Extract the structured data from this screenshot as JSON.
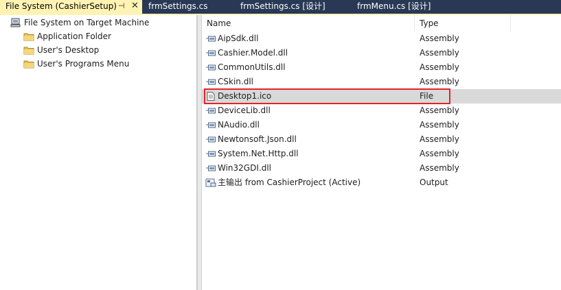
{
  "tabs": [
    {
      "label": "File System (CashierSetup)",
      "pin_glyph": "⊣",
      "close_glyph": "✕"
    },
    {
      "label": "frmSettings.cs"
    },
    {
      "label": "frmSettings.cs [设计]"
    },
    {
      "label": "frmMenu.cs [设计]"
    }
  ],
  "tree": {
    "root": {
      "label": "File System on Target Machine",
      "icon": "computer-icon"
    },
    "children": [
      {
        "label": "Application Folder",
        "icon": "folder-icon"
      },
      {
        "label": "User's Desktop",
        "icon": "folder-icon"
      },
      {
        "label": "User's Programs Menu",
        "icon": "folder-icon"
      }
    ]
  },
  "list": {
    "columns": {
      "name": "Name",
      "type": "Type"
    },
    "rows": [
      {
        "name": "AipSdk.dll",
        "type": "Assembly",
        "icon": "assembly-icon"
      },
      {
        "name": "Cashier.Model.dll",
        "type": "Assembly",
        "icon": "assembly-icon"
      },
      {
        "name": "CommonUtils.dll",
        "type": "Assembly",
        "icon": "assembly-icon"
      },
      {
        "name": "CSkin.dll",
        "type": "Assembly",
        "icon": "assembly-icon"
      },
      {
        "name": "Desktop1.ico",
        "type": "File",
        "icon": "file-icon",
        "selected": true
      },
      {
        "name": "DeviceLib.dll",
        "type": "Assembly",
        "icon": "assembly-icon"
      },
      {
        "name": "NAudio.dll",
        "type": "Assembly",
        "icon": "assembly-icon"
      },
      {
        "name": "Newtonsoft.Json.dll",
        "type": "Assembly",
        "icon": "assembly-icon"
      },
      {
        "name": "System.Net.Http.dll",
        "type": "Assembly",
        "icon": "assembly-icon"
      },
      {
        "name": "Win32GDI.dll",
        "type": "Assembly",
        "icon": "assembly-icon"
      },
      {
        "name": "主输出 from CashierProject (Active)",
        "type": "Output",
        "icon": "project-output-icon"
      }
    ]
  },
  "colors": {
    "tab_bar": "#293955",
    "active_tab": "#fff3b4",
    "selection": "#d9d9d9",
    "highlight_border": "#e0242b"
  }
}
